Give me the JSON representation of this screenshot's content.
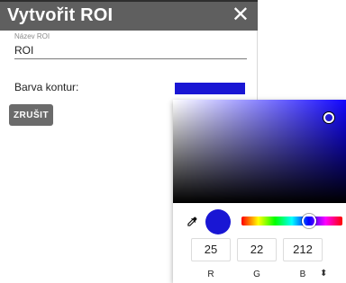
{
  "dialog": {
    "title": "Vytvořit ROI",
    "close_glyph": "✕",
    "name_label": "Název ROI",
    "name_value": "ROI",
    "color_label": "Barva kontur:",
    "color": "#1916d4",
    "cancel_label": "ZRUŠIT"
  },
  "picker": {
    "hue_color": "#1206ff",
    "saturation": 0.9,
    "value": 0.83,
    "hue_fraction": 0.67,
    "current_color": "#1916d4",
    "icons": {
      "eyedropper": "eyedropper-icon",
      "toggle": "up-down-icon"
    },
    "rgb": {
      "r": "25",
      "g": "22",
      "b": "212"
    },
    "labels": {
      "r": "R",
      "g": "G",
      "b": "B"
    },
    "toggle_glyph": "⬍"
  }
}
